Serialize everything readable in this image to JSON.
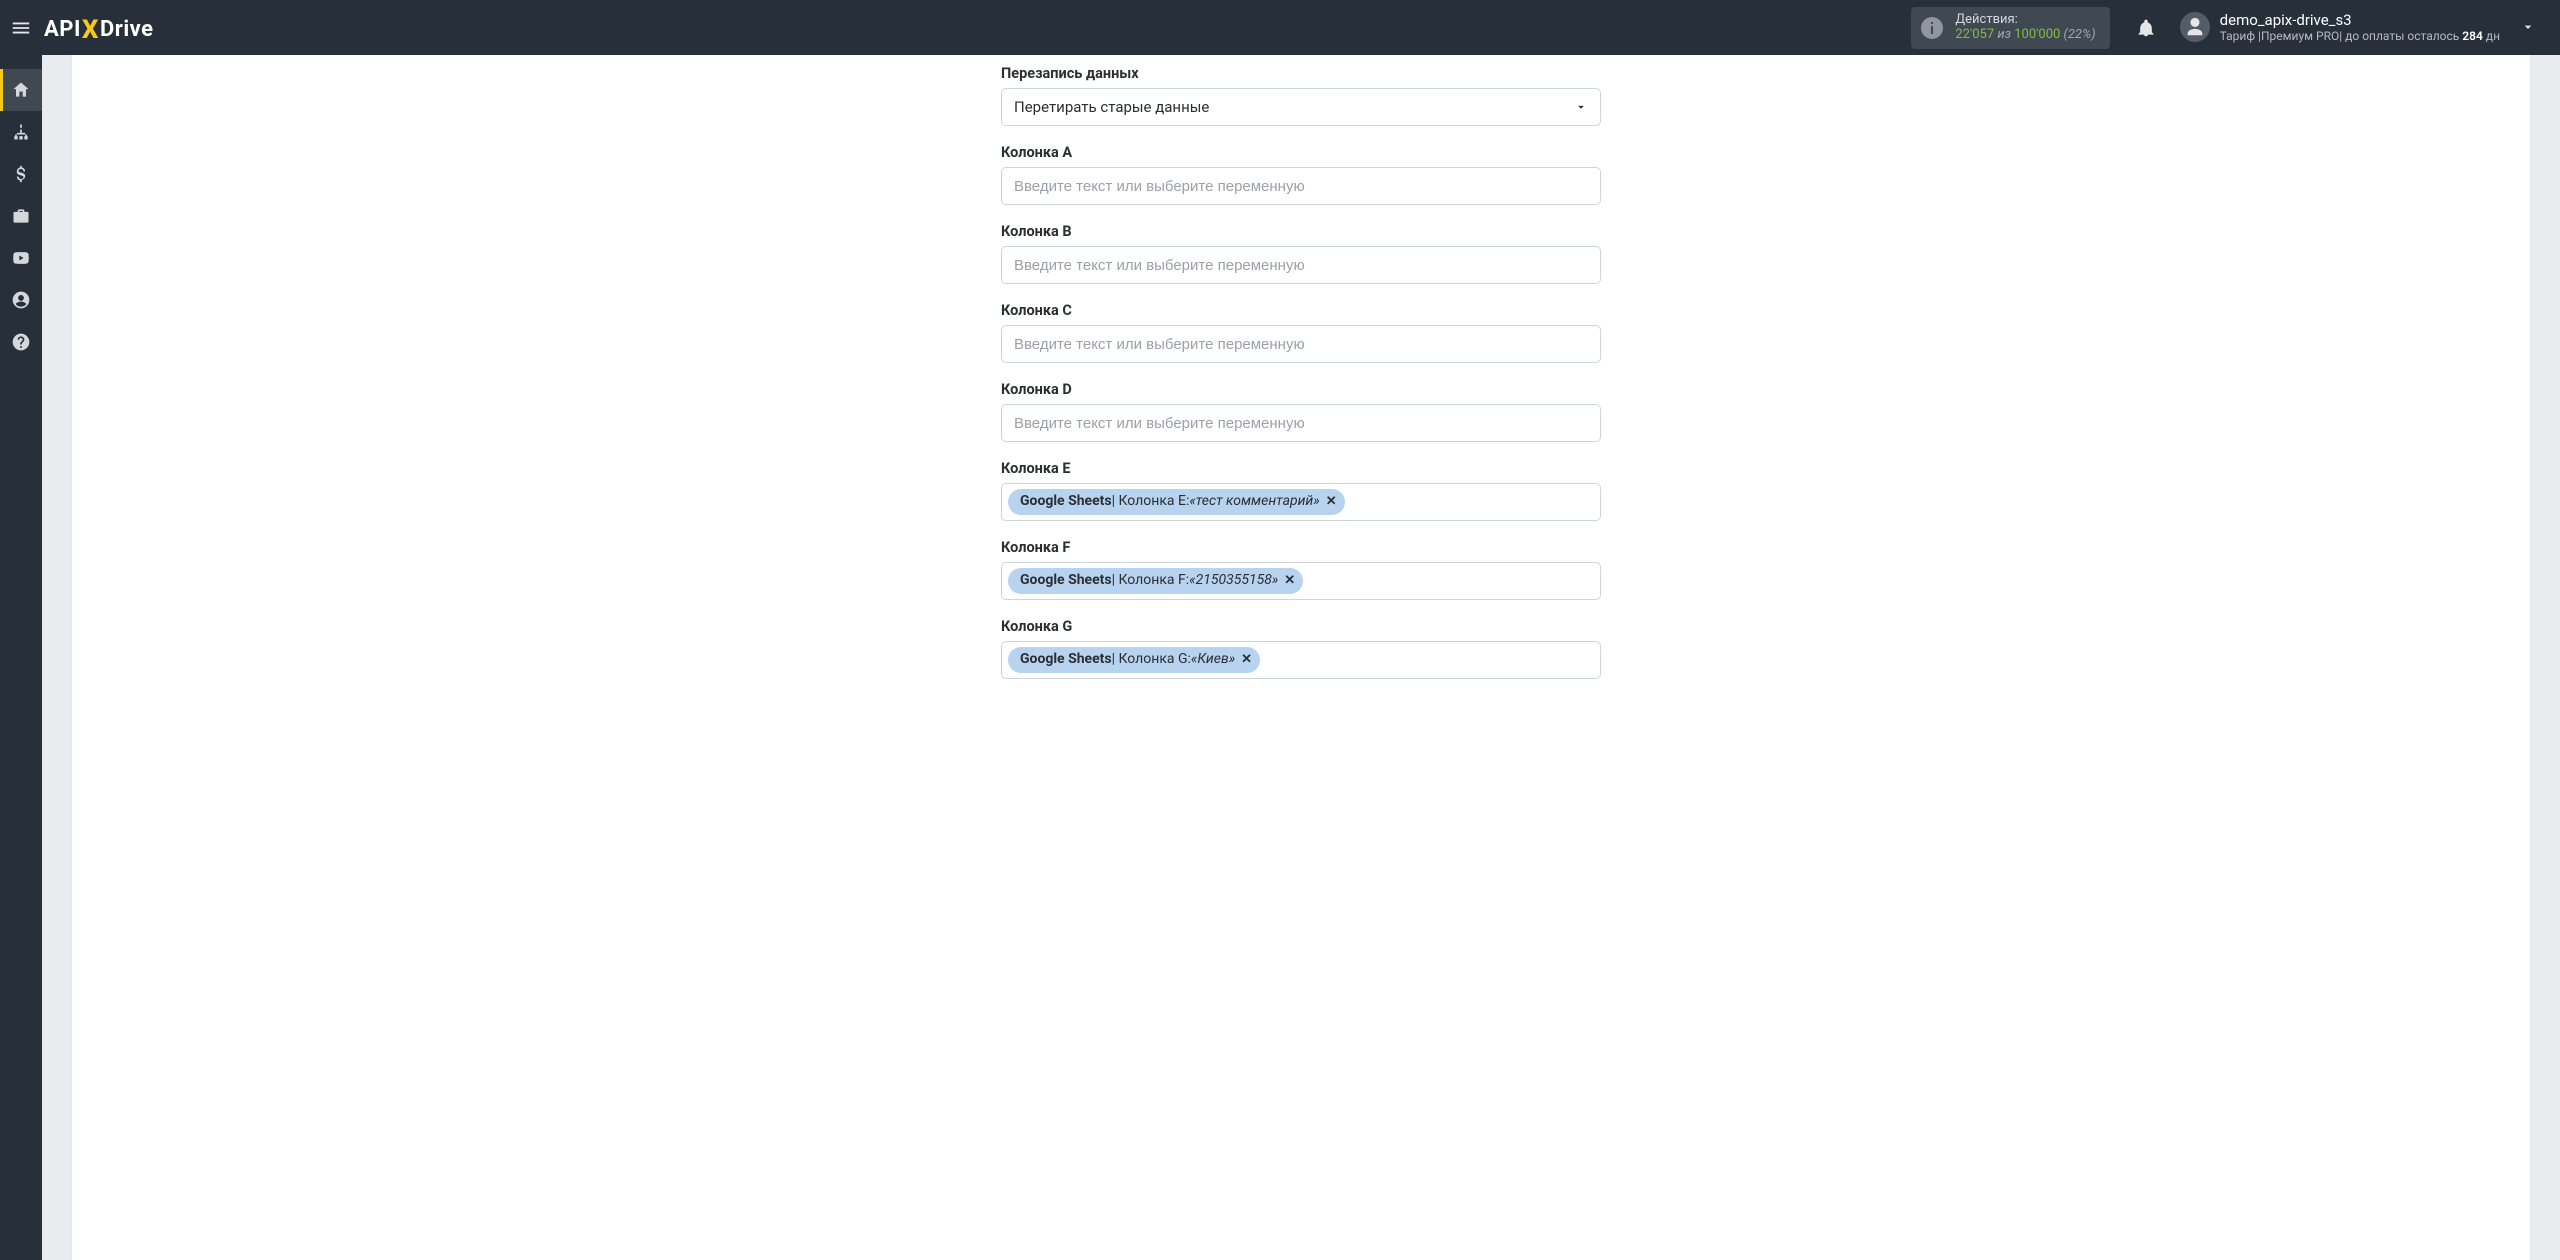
{
  "header": {
    "logo_prefix": "API",
    "logo_x": "X",
    "logo_suffix": "Drive",
    "actions": {
      "title": "Действия:",
      "count": "22'057",
      "of": " из ",
      "limit": "100'000",
      "pct": " (22%)"
    },
    "user": {
      "name": "demo_apix-drive_s3",
      "sub_prefix": "Тариф |Премиум PRO| до оплаты осталось ",
      "days": "284",
      "sub_suffix": " дн"
    }
  },
  "form": {
    "overwrite": {
      "label": "Перезапись данных",
      "value": "Перетирать старые данные"
    },
    "placeholder": "Введите текст или выберите переменную",
    "columns": {
      "a": {
        "label": "Колонка A"
      },
      "b": {
        "label": "Колонка B"
      },
      "c": {
        "label": "Колонка C"
      },
      "d": {
        "label": "Колонка D"
      },
      "e": {
        "label": "Колонка E",
        "token": {
          "src": "Google Sheets",
          "mid": " | Колонка E: ",
          "val": "«тест комментарий»"
        }
      },
      "f": {
        "label": "Колонка F",
        "token": {
          "src": "Google Sheets",
          "mid": " | Колонка F: ",
          "val": "«2150355158»"
        }
      },
      "g": {
        "label": "Колонка G",
        "token": {
          "src": "Google Sheets",
          "mid": " | Колонка G: ",
          "val": "«Киев»"
        }
      }
    }
  }
}
